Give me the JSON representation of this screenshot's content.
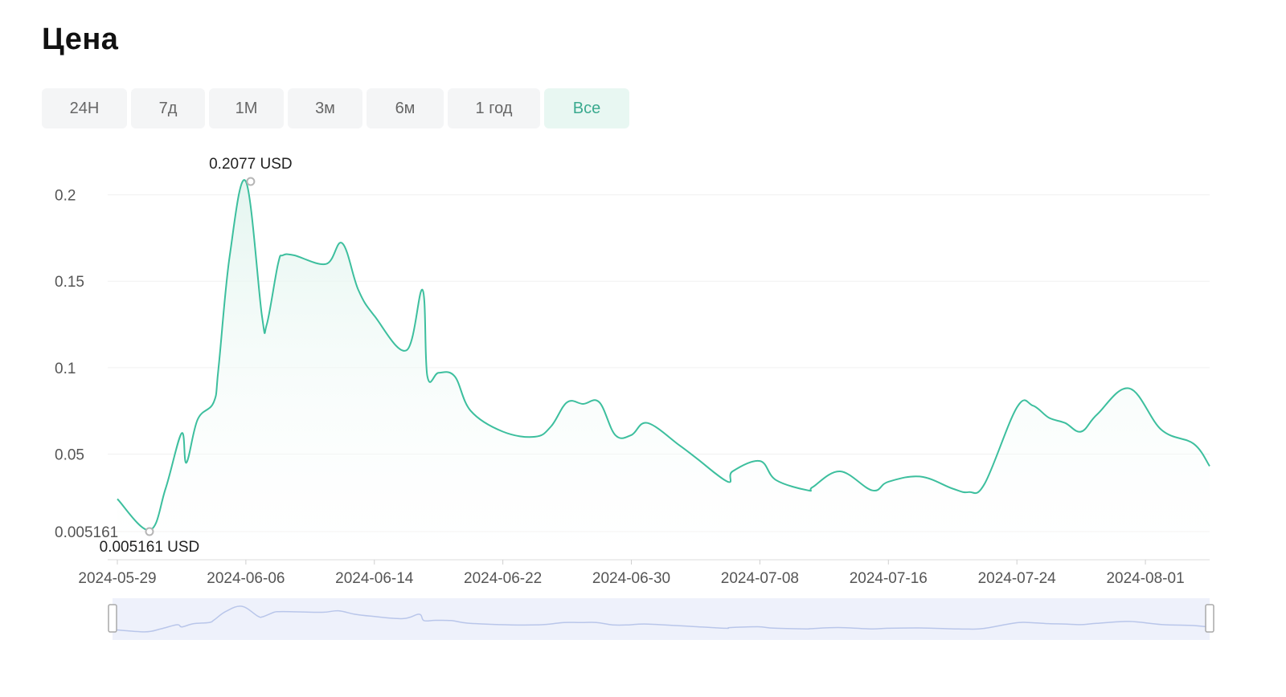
{
  "page": {
    "title": "Цена"
  },
  "tabs": [
    {
      "label": "24H",
      "active": false
    },
    {
      "label": "7д",
      "active": false
    },
    {
      "label": "1М",
      "active": false
    },
    {
      "label": "3м",
      "active": false
    },
    {
      "label": "6м",
      "active": false
    },
    {
      "label": "1 год",
      "active": false
    },
    {
      "label": "Все",
      "active": true
    }
  ],
  "colors": {
    "line": "#3dbf9e",
    "area_top": "#e3f5ef",
    "grid": "#f0f0f0",
    "tab_active_text": "#3aaa8f",
    "tab_active_bg": "#e8f7f2",
    "navigator_bg": "#eef1fb",
    "navigator_line": "#b9c6ea"
  },
  "chart_data": {
    "type": "area",
    "title": "",
    "xlabel": "",
    "ylabel": "",
    "x_ticks": [
      "2024-05-29",
      "2024-06-06",
      "2024-06-14",
      "2024-06-22",
      "2024-06-30",
      "2024-07-08",
      "2024-07-16",
      "2024-07-24",
      "2024-08-01"
    ],
    "y_ticks": [
      0.005161,
      0.05,
      0.1,
      0.15,
      0.2
    ],
    "y_tick_labels": [
      "0.005161",
      "0.05",
      "0.1",
      "0.15",
      "0.2"
    ],
    "ylim": [
      0.005161,
      0.2077
    ],
    "xlim": [
      "2024-05-29",
      "2024-08-05"
    ],
    "grid": true,
    "series": [
      {
        "x": [
          "2024-05-29",
          "2024-05-31",
          "2024-06-01",
          "2024-06-02",
          "2024-06-02",
          "2024-06-03",
          "2024-06-04",
          "2024-06-04",
          "2024-06-05",
          "2024-06-06",
          "2024-06-07",
          "2024-06-07",
          "2024-06-08",
          "2024-06-08",
          "2024-06-09",
          "2024-06-11",
          "2024-06-12",
          "2024-06-13",
          "2024-06-14",
          "2024-06-16",
          "2024-06-17",
          "2024-06-17",
          "2024-06-18",
          "2024-06-19",
          "2024-06-20",
          "2024-06-22",
          "2024-06-24",
          "2024-06-25",
          "2024-06-26",
          "2024-06-27",
          "2024-06-28",
          "2024-06-29",
          "2024-06-30",
          "2024-07-01",
          "2024-07-03",
          "2024-07-04",
          "2024-07-06",
          "2024-07-06",
          "2024-07-08",
          "2024-07-09",
          "2024-07-11",
          "2024-07-11",
          "2024-07-13",
          "2024-07-15",
          "2024-07-16",
          "2024-07-18",
          "2024-07-20",
          "2024-07-21",
          "2024-07-22",
          "2024-07-24",
          "2024-07-25",
          "2024-07-26",
          "2024-07-27",
          "2024-07-28",
          "2024-07-29",
          "2024-07-31",
          "2024-08-02",
          "2024-08-04",
          "2024-08-05"
        ],
        "y": [
          0.024,
          0.006,
          0.03,
          0.062,
          0.045,
          0.07,
          0.08,
          0.1,
          0.165,
          0.2077,
          0.13,
          0.125,
          0.16,
          0.165,
          0.165,
          0.16,
          0.172,
          0.145,
          0.13,
          0.11,
          0.145,
          0.095,
          0.097,
          0.095,
          0.075,
          0.063,
          0.06,
          0.066,
          0.08,
          0.079,
          0.08,
          0.061,
          0.061,
          0.068,
          0.055,
          0.048,
          0.034,
          0.04,
          0.046,
          0.035,
          0.029,
          0.031,
          0.04,
          0.029,
          0.034,
          0.037,
          0.03,
          0.028,
          0.033,
          0.077,
          0.078,
          0.071,
          0.068,
          0.063,
          0.073,
          0.088,
          0.064,
          0.056,
          0.043
        ]
      }
    ],
    "annotations": [
      {
        "label": "0.2077 USD",
        "x": "2024-06-06",
        "y": 0.2077,
        "kind": "max"
      },
      {
        "label": "0.005161 USD",
        "x": "2024-05-31",
        "y": 0.005161,
        "kind": "min"
      }
    ]
  }
}
